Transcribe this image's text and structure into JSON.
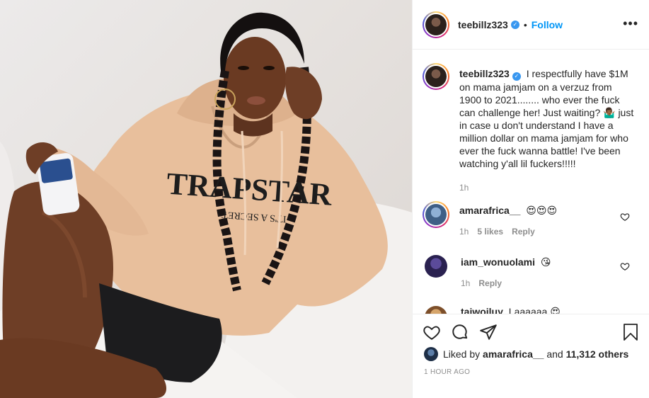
{
  "post": {
    "username": "teebillz323",
    "follow_label": "Follow",
    "separator": "•",
    "more_label": "•••",
    "verified_glyph": "✓"
  },
  "caption": {
    "username": "teebillz323",
    "text": "I respectfully have $1M on mama jamjam on a verzuz from 1900 to 2021........ who ever the fuck can challenge her! Just waiting? 🤷🏾‍♂️ just in case u don't understand I have a million dollar on mama jamjam for who ever the fuck wanna battle! I've been watching y'all lil fuckers!!!!!",
    "time": "1h"
  },
  "comments": [
    {
      "username": "amarafrica__",
      "text": "😍😍😍",
      "time": "1h",
      "likes": "5 likes",
      "reply": "Reply",
      "avatar_color": "#6b8fb5"
    },
    {
      "username": "iam_wonuolami",
      "text": "😘",
      "time": "1h",
      "likes": "",
      "reply": "Reply",
      "avatar_color": "#4a3a8a"
    },
    {
      "username": "taiwoiluy",
      "text": "Laaaaaa 😍",
      "time": "",
      "likes": "",
      "reply": "",
      "avatar_color": "#c8955a"
    }
  ],
  "actions": {
    "liked_by_prefix": "Liked by",
    "liked_by_user": "amarafrica__",
    "liked_by_and": "and",
    "liked_by_count": "11,312 others",
    "timestamp": "1 HOUR AGO"
  },
  "icons": {
    "like": "heart-icon",
    "comment": "comment-icon",
    "share": "paper-plane-icon",
    "save": "bookmark-icon",
    "more": "more-options-icon"
  },
  "colors": {
    "accent": "#0095f6",
    "verified": "#3897f0",
    "meta_gray": "#8e8e8e",
    "text": "#262626"
  }
}
